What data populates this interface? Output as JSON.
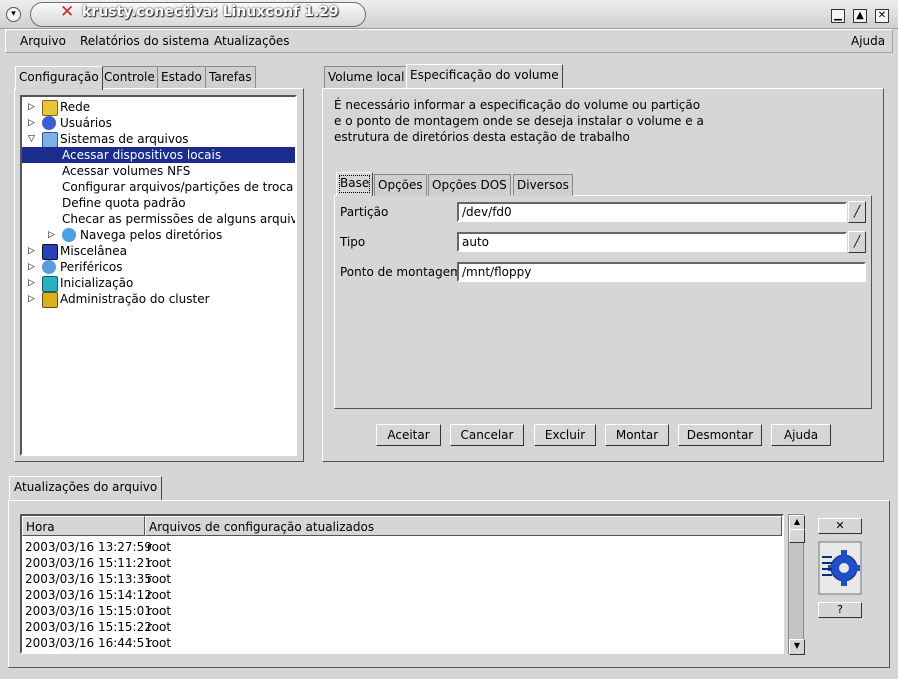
{
  "window": {
    "title": "krusty.conectiva: Linuxconf 1.29",
    "menu_glyph": "▾",
    "minimize_glyph": "▁",
    "maximize_glyph": "▲",
    "close_glyph": "✕"
  },
  "menubar": {
    "items": [
      "Arquivo",
      "Relatórios do sistema",
      "Atualizações"
    ],
    "help": "Ajuda"
  },
  "left_tabs": [
    "Configuração",
    "Controle",
    "Estado",
    "Tarefas"
  ],
  "tree": {
    "items": [
      {
        "label": "Rede",
        "icon": "network-icon",
        "expander": "▷",
        "depth": 0
      },
      {
        "label": "Usuários",
        "icon": "users-icon",
        "expander": "▷",
        "depth": 0
      },
      {
        "label": "Sistemas de arquivos",
        "icon": "filesystem-icon",
        "expander": "▽",
        "depth": 0
      },
      {
        "label": "Acessar dispositivos locais",
        "icon": "",
        "expander": "",
        "depth": 1,
        "selected": true
      },
      {
        "label": "Acessar volumes NFS",
        "icon": "",
        "expander": "",
        "depth": 1
      },
      {
        "label": "Configurar arquivos/partições de troca (sv",
        "icon": "",
        "expander": "",
        "depth": 1
      },
      {
        "label": "Define quota padrão",
        "icon": "",
        "expander": "",
        "depth": 1
      },
      {
        "label": "Checar as permissões de alguns arquivos",
        "icon": "",
        "expander": "",
        "depth": 1
      },
      {
        "label": "Navega pelos diretórios",
        "icon": "browse-icon",
        "expander": "▷",
        "depth": 1
      },
      {
        "label": "Miscelânea",
        "icon": "misc-icon",
        "expander": "▷",
        "depth": 0
      },
      {
        "label": "Periféricos",
        "icon": "peripherals-icon",
        "expander": "▷",
        "depth": 0
      },
      {
        "label": "Inicialização",
        "icon": "boot-icon",
        "expander": "▷",
        "depth": 0
      },
      {
        "label": "Administração do cluster",
        "icon": "cluster-icon",
        "expander": "▷",
        "depth": 0
      }
    ]
  },
  "right_tabs": [
    "Volume local",
    "Especificação do volume"
  ],
  "description": [
    "É necessário informar a especificação do volume ou partição",
    "e o ponto de montagem onde se deseja instalar o volume e a",
    "estrutura de diretórios desta estação de trabalho"
  ],
  "inner_tabs": [
    "Base",
    "Opções",
    "Opções DOS",
    "Diversos"
  ],
  "form": {
    "particao_label": "Partição",
    "particao_value": "/dev/fd0",
    "tipo_label": "Tipo",
    "tipo_value": "auto",
    "ponto_label": "Ponto de montagem",
    "ponto_value": "/mnt/floppy",
    "combo_glyph": "╱"
  },
  "buttons": [
    "Aceitar",
    "Cancelar",
    "Excluir",
    "Montar",
    "Desmontar",
    "Ajuda"
  ],
  "bottom": {
    "tab": "Atualizações do arquivo",
    "columns": [
      "Hora",
      "Arquivos de configuração atualizados"
    ],
    "rows": [
      [
        "2003/03/16 13:27:59",
        "root"
      ],
      [
        "2003/03/16 15:11:21",
        "root"
      ],
      [
        "2003/03/16 15:13:35",
        "root"
      ],
      [
        "2003/03/16 15:14:12",
        "root"
      ],
      [
        "2003/03/16 15:15:01",
        "root"
      ],
      [
        "2003/03/16 15:15:22",
        "root"
      ],
      [
        "2003/03/16 16:44:51",
        "root"
      ]
    ],
    "close_glyph": "✕",
    "help_glyph": "?",
    "scroll_up": "▲",
    "scroll_down": "▼"
  },
  "colors": {
    "selection": "#1a2c8c",
    "title_x": "#d62020"
  }
}
